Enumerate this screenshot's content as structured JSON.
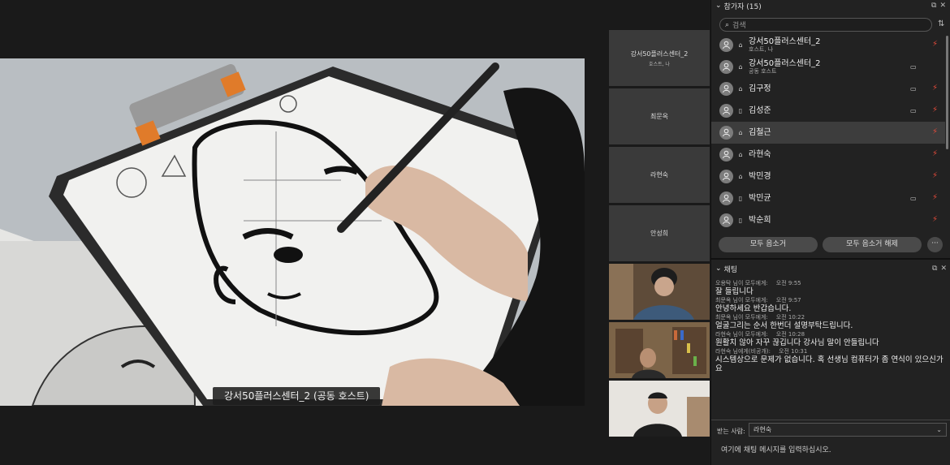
{
  "main": {
    "speaker_label": "강서50플러스센터_2 (공동 호스트)"
  },
  "thumbnails": [
    {
      "name": "강서50플러스센터_2",
      "sub": "호스트, 나",
      "type": "name"
    },
    {
      "name": "최문옥",
      "sub": "",
      "type": "name"
    },
    {
      "name": "라현숙",
      "sub": "",
      "type": "name"
    },
    {
      "name": "안성희",
      "sub": "",
      "type": "name"
    },
    {
      "name": "",
      "sub": "",
      "type": "video"
    },
    {
      "name": "",
      "sub": "",
      "type": "video"
    },
    {
      "name": "",
      "sub": "",
      "type": "video"
    }
  ],
  "participants_panel": {
    "title": "참가자 (15)",
    "search_placeholder": "검색",
    "participants": [
      {
        "name": "강서50플러스센터_2",
        "role": "호스트, 나",
        "device": "pc",
        "camera": false
      },
      {
        "name": "강서50플러스센터_2",
        "role": "공동 호스트",
        "device": "pc",
        "camera": true
      },
      {
        "name": "김구정",
        "role": "",
        "device": "pc",
        "camera": true
      },
      {
        "name": "김성준",
        "role": "",
        "device": "phone",
        "camera": true
      },
      {
        "name": "김철근",
        "role": "",
        "device": "pc",
        "camera": false,
        "selected": true
      },
      {
        "name": "라현숙",
        "role": "",
        "device": "pc",
        "camera": false
      },
      {
        "name": "박민경",
        "role": "",
        "device": "pc",
        "camera": false
      },
      {
        "name": "박민균",
        "role": "",
        "device": "phone",
        "camera": true
      },
      {
        "name": "박순희",
        "role": "",
        "device": "phone",
        "camera": false
      }
    ],
    "mute_all_label": "모두 음소거",
    "unmute_all_label": "모두 음소거 해제",
    "more_label": "···"
  },
  "chat_panel": {
    "title": "채팅",
    "messages": [
      {
        "meta": "오용탁 님이 모두에게:",
        "time": "오전 9:55",
        "text": "잘 들립니다"
      },
      {
        "meta": "최문옥 님이 모두에게:",
        "time": "오전 9:57",
        "text": "안녕하세요 반갑습니다."
      },
      {
        "meta": "최문옥 님이 모두에게:",
        "time": "오전 10:22",
        "text": "얼굴그리는 순서 한번더 설명부탁드립니다."
      },
      {
        "meta": "라현숙 님이 모두에게:",
        "time": "오전 10:28",
        "text": "원활치 않아 자꾸 끊깁니다 강사님 말이 안들립니다"
      },
      {
        "meta": "라현숙 님에게(비공개):",
        "time": "오전 10:31",
        "text": "시스템상으로 문제가 없습니다. 혹 선생님 컴퓨터가 좀 연식이 있으신가요"
      }
    ],
    "to_label": "받는 사람:",
    "to_value": "라현숙",
    "input_placeholder": "여기에 채팅 메시지를 입력하십시오."
  },
  "colors": {
    "background": "#1a1a1a",
    "panel": "#222222",
    "muted_mic": "#e24a3a"
  }
}
